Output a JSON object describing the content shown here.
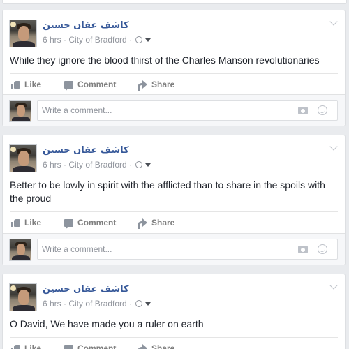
{
  "posts": [
    {
      "author": "كاشف عفان حسين",
      "time": "6 hrs",
      "location": "City of Bradford",
      "text": "While they ignore the blood thirst of the Charles Manson revolutionaries"
    },
    {
      "author": "كاشف عفان حسين",
      "time": "6 hrs",
      "location": "City of Bradford",
      "text": "Better to be lowly in spirit with the afflicted than to share in the spoils with the proud"
    },
    {
      "author": "كاشف عفان حسين",
      "time": "6 hrs",
      "location": "City of Bradford",
      "text": "O David, We have made you a ruler on earth"
    }
  ],
  "actions": {
    "like": "Like",
    "comment": "Comment",
    "share": "Share"
  },
  "comment_box": {
    "placeholder": "Write a comment..."
  },
  "separators": {
    "meta": " · "
  },
  "icons": {
    "audience": "globe-icon",
    "privacy_menu": "caret-down-icon",
    "options": "chevron-down-icon",
    "like": "thumbs-up-icon",
    "comment": "speech-bubble-icon",
    "share": "share-arrow-icon",
    "camera": "camera-icon",
    "emoji": "smiley-icon"
  },
  "colors": {
    "background": "#e9ebee",
    "author_link": "#365899",
    "meta_text": "#90949c",
    "body_text": "#1d2129",
    "action_text": "#7f7f7f"
  }
}
